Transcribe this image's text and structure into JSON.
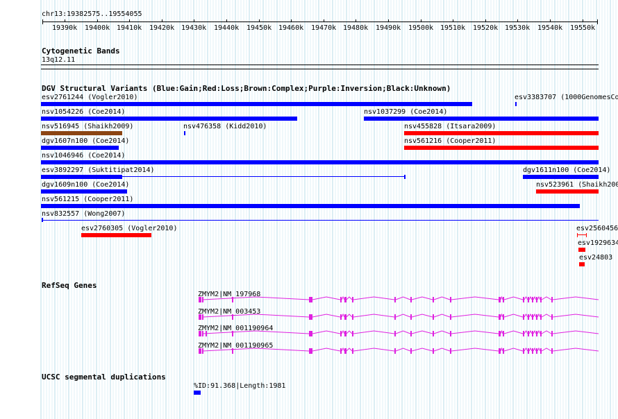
{
  "region": "chr13:19382575..19554055",
  "ruler": {
    "ticks": [
      "19390k",
      "19400k",
      "19410k",
      "19420k",
      "19430k",
      "19440k",
      "19450k",
      "19460k",
      "19470k",
      "19480k",
      "19490k",
      "19500k",
      "19510k",
      "19520k",
      "19530k",
      "19540k",
      "19550k"
    ]
  },
  "cyto": {
    "title": "Cytogenetic Bands",
    "band": "13q12.11"
  },
  "dgv": {
    "title": "DGV Structural Variants (Blue:Gain;Red:Loss;Brown:Complex;Purple:Inversion;Black:Unknown)",
    "colors": {
      "gain": "#0000ff",
      "loss": "#ff0000",
      "complex": "#8b4513"
    },
    "variants": [
      {
        "label": "esv2761244 (Vogler2010)",
        "type": "gain"
      },
      {
        "label": "esv3383707 (1000GenomesCo",
        "type": "gain"
      },
      {
        "label": "nsv1054226 (Coe2014)",
        "type": "gain"
      },
      {
        "label": "nsv1037299 (Coe2014)",
        "type": "gain"
      },
      {
        "label": "nsv516945 (Shaikh2009)",
        "type": "complex"
      },
      {
        "label": "nsv476358 (Kidd2010)",
        "type": "gain"
      },
      {
        "label": "nsv455828 (Itsara2009)",
        "type": "loss"
      },
      {
        "label": "dgv1607n100 (Coe2014)",
        "type": "gain"
      },
      {
        "label": "nsv561216 (Cooper2011)",
        "type": "loss"
      },
      {
        "label": "nsv1046946 (Coe2014)",
        "type": "gain"
      },
      {
        "label": "esv3892297 (Suktitipat2014)",
        "type": "gain"
      },
      {
        "label": "dgv1611n100 (Coe2014)",
        "type": "gain"
      },
      {
        "label": "dgv1609n100 (Coe2014)",
        "type": "gain"
      },
      {
        "label": "nsv523961 (Shaikh200",
        "type": "loss"
      },
      {
        "label": "nsv561215 (Cooper2011)",
        "type": "gain"
      },
      {
        "label": "nsv832557 (Wong2007)",
        "type": "gain"
      },
      {
        "label": "esv2760305 (Vogler2010)",
        "type": "loss"
      },
      {
        "label": "esv2560456",
        "type": "loss"
      },
      {
        "label": "esv1929634",
        "type": "loss"
      },
      {
        "label": "esv24803",
        "type": "loss"
      }
    ]
  },
  "refseq": {
    "title": "RefSeq Genes",
    "color": "#e020e0",
    "genes": [
      "ZMYM2|NM_197968",
      "ZMYM2|NM_003453",
      "ZMYM2|NM_001190964",
      "ZMYM2|NM_001190965"
    ]
  },
  "segdup": {
    "title": "UCSC segmental duplications",
    "label": "%ID:91.368|Length:1981",
    "color": "#0000ff"
  }
}
